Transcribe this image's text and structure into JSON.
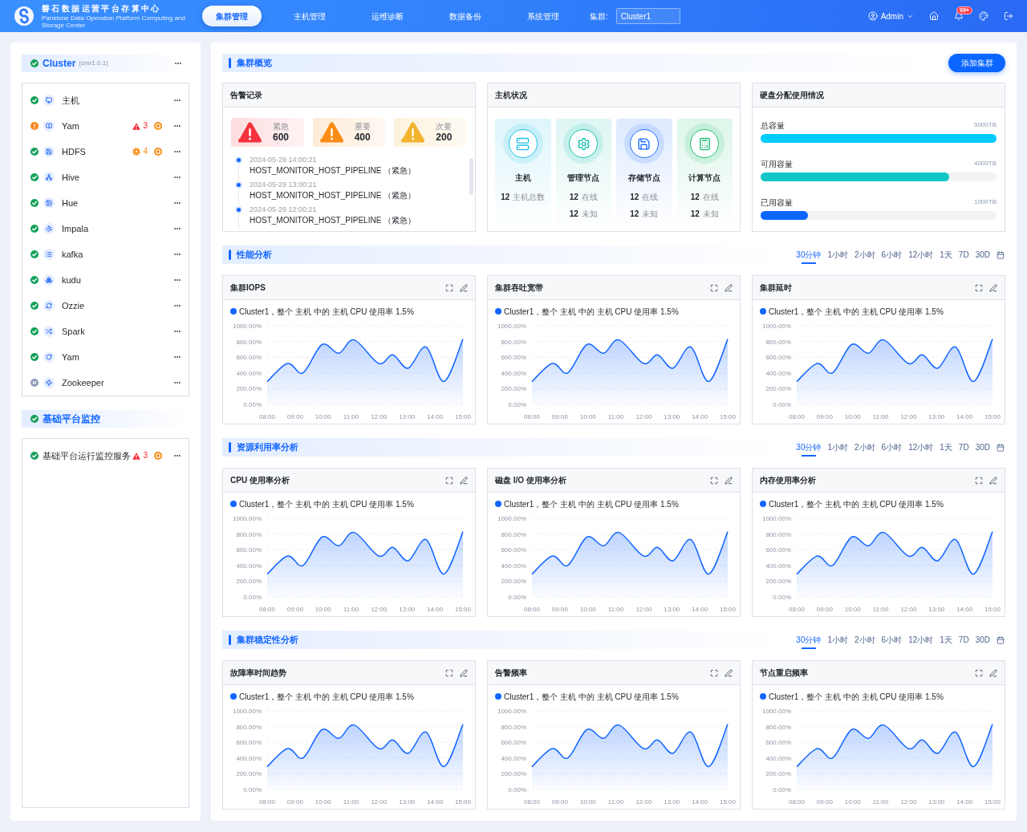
{
  "header": {
    "logo_title": "磐石数据运营平台存算中心",
    "logo_subtitle": "Panstone Data Operation Platform Computing and Storage Center",
    "nav": [
      {
        "label": "集群管理",
        "selected": true
      },
      {
        "label": "主机管理",
        "selected": false
      },
      {
        "label": "运维诊断",
        "selected": false
      },
      {
        "label": "数据备份",
        "selected": false
      },
      {
        "label": "系统管理",
        "selected": false
      }
    ],
    "cluster_label": "集群:",
    "cluster_value": "Cluster1",
    "user": "Admin",
    "notification_badge": "99+"
  },
  "sidebar": {
    "sections": [
      {
        "title": "Cluster",
        "version": "(cmr1.0.1)",
        "kind": "ok",
        "has_menu": true,
        "items": [
          {
            "name": "主机",
            "kind": "ok"
          },
          {
            "name": "Yam",
            "kind": "warning",
            "alert": {
              "kind": "critical",
              "count": "3"
            }
          },
          {
            "name": "HDFS",
            "kind": "ok",
            "alert": {
              "kind": "gear",
              "count": "4"
            }
          },
          {
            "name": "Hive",
            "kind": "ok"
          },
          {
            "name": "Hue",
            "kind": "ok"
          },
          {
            "name": "Impala",
            "kind": "ok"
          },
          {
            "name": "kafka",
            "kind": "ok"
          },
          {
            "name": "kudu",
            "kind": "ok"
          },
          {
            "name": "Ozzie",
            "kind": "ok"
          },
          {
            "name": "Spark",
            "kind": "ok"
          },
          {
            "name": "Yam",
            "kind": "ok"
          },
          {
            "name": "Zookeeper",
            "kind": "paused"
          }
        ]
      },
      {
        "title": "基础平台监控",
        "kind": "ok",
        "has_menu": false,
        "items": [
          {
            "name": "基础平台运行监控服务",
            "kind": "ok",
            "alert": {
              "kind": "critical",
              "count": "3"
            }
          }
        ]
      }
    ]
  },
  "overview": {
    "title": "集群概览",
    "add_button": "添加集群",
    "alerts_card": {
      "title": "告警记录",
      "levels": [
        {
          "label": "紧急",
          "count": "600",
          "color": "#f5333f"
        },
        {
          "label": "重要",
          "count": "400",
          "color": "#fa8c16"
        },
        {
          "label": "次要",
          "count": "200",
          "color": "#f2b32e"
        }
      ],
      "records": [
        {
          "time": "2024-05-29 14:00:21",
          "text": "HOST_MONITOR_HOST_PIPELINE （紧急）"
        },
        {
          "time": "2024-05-29 13:00:21",
          "text": "HOST_MONITOR_HOST_PIPELINE （紧急）"
        },
        {
          "time": "2024-05-29 12:00:21",
          "text": "HOST_MONITOR_HOST_PIPELINE （紧急）"
        }
      ]
    },
    "hosts_card": {
      "title": "主机状况",
      "tiles": [
        {
          "kind": "server",
          "name": "主机",
          "color": "#1fc2e6",
          "stats": [
            {
              "value": "12",
              "label": "主机总数"
            }
          ]
        },
        {
          "kind": "gear",
          "name": "管理节点",
          "color": "#17bfae",
          "stats": [
            {
              "value": "12",
              "label": "在线"
            },
            {
              "value": "12",
              "label": "未知"
            }
          ]
        },
        {
          "kind": "disk",
          "name": "存储节点",
          "color": "#1f6fff",
          "stats": [
            {
              "value": "12",
              "label": "在线"
            },
            {
              "value": "12",
              "label": "未知"
            }
          ]
        },
        {
          "kind": "calculator",
          "name": "计算节点",
          "color": "#1fbf74",
          "stats": [
            {
              "value": "12",
              "label": "在线"
            },
            {
              "value": "12",
              "label": "未知"
            }
          ]
        }
      ]
    },
    "disk_card": {
      "title": "硬盘分配使用情况",
      "rows": [
        {
          "label": "总容量",
          "value": "5000TB",
          "level": 1,
          "color": "#00cbff"
        },
        {
          "label": "可用容量",
          "value": "4000TB",
          "level": 0.8,
          "color": "#14c5c5"
        },
        {
          "label": "已用容量",
          "value": "1000TB",
          "level": 0.2,
          "color": "#0a66ff"
        }
      ]
    }
  },
  "analysis_sections": [
    {
      "title": "性能分析",
      "ranges": [
        {
          "label": "30分钟",
          "selected": true
        },
        {
          "label": "1小时",
          "selected": false
        },
        {
          "label": "2小时",
          "selected": false
        },
        {
          "label": "6小时",
          "selected": false
        },
        {
          "label": "12小时",
          "selected": false
        },
        {
          "label": "1天",
          "selected": false
        },
        {
          "label": "7D",
          "selected": false
        },
        {
          "label": "30D",
          "selected": false
        }
      ],
      "charts": [
        {
          "title": "集群IOPS",
          "chart_data": {
            "type": "area",
            "grid": true,
            "series": [
              {
                "name": "Cluster1，整个 主机 中的 主机 CPU 使用率 1.5%",
                "color": "#1366ff",
                "values": [
                  290,
                  520,
                  400,
                  760,
                  650,
                  820,
                  520,
                  630,
                  460,
                  730,
                  290,
                  830
                ]
              }
            ],
            "x": [
              8,
              8.73,
              9.28,
              9.96,
              10.56,
              11.11,
              11.99,
              12.49,
              13.04,
              13.68,
              14.32,
              15
            ],
            "xlim": [
              8,
              15
            ],
            "ylim": [
              0,
              1000
            ],
            "xticks": [
              {
                "value": 8,
                "label": "08:00"
              },
              {
                "value": 9,
                "label": "09:00"
              },
              {
                "value": 10,
                "label": "10:00"
              },
              {
                "value": 11,
                "label": "11:00"
              },
              {
                "value": 12,
                "label": "12:00"
              },
              {
                "value": 13,
                "label": "13:00"
              },
              {
                "value": 14,
                "label": "14:00"
              },
              {
                "value": 15,
                "label": "15:00"
              }
            ],
            "yticks": [
              {
                "value": 0,
                "label": "0.00%"
              },
              {
                "value": 200,
                "label": "200.00%"
              },
              {
                "value": 400,
                "label": "400.00%"
              },
              {
                "value": 600,
                "label": "600.00%"
              },
              {
                "value": 800,
                "label": "800.00%"
              },
              {
                "value": 1000,
                "label": "1000.00%"
              }
            ]
          }
        },
        {
          "title": "集群吞吐宽带",
          "chart_data": {
            "type": "area",
            "grid": true,
            "series": [
              {
                "name": "Cluster1，整个 主机 中的 主机 CPU 使用率 1.5%",
                "color": "#1366ff",
                "values": [
                  290,
                  520,
                  400,
                  760,
                  650,
                  820,
                  520,
                  630,
                  460,
                  730,
                  290,
                  830
                ]
              }
            ],
            "x": [
              8,
              8.73,
              9.28,
              9.96,
              10.56,
              11.11,
              11.99,
              12.49,
              13.04,
              13.68,
              14.32,
              15
            ],
            "xlim": [
              8,
              15
            ],
            "ylim": [
              0,
              1000
            ],
            "xticks": [
              {
                "value": 8,
                "label": "08:00"
              },
              {
                "value": 9,
                "label": "09:00"
              },
              {
                "value": 10,
                "label": "10:00"
              },
              {
                "value": 11,
                "label": "11:00"
              },
              {
                "value": 12,
                "label": "12:00"
              },
              {
                "value": 13,
                "label": "13:00"
              },
              {
                "value": 14,
                "label": "14:00"
              },
              {
                "value": 15,
                "label": "15:00"
              }
            ],
            "yticks": [
              {
                "value": 0,
                "label": "0.00%"
              },
              {
                "value": 200,
                "label": "200.00%"
              },
              {
                "value": 400,
                "label": "400.00%"
              },
              {
                "value": 600,
                "label": "600.00%"
              },
              {
                "value": 800,
                "label": "800.00%"
              },
              {
                "value": 1000,
                "label": "1000.00%"
              }
            ]
          }
        },
        {
          "title": "集群延时",
          "chart_data": {
            "type": "area",
            "grid": true,
            "series": [
              {
                "name": "Cluster1，整个 主机 中的 主机 CPU 使用率 1.5%",
                "color": "#1366ff",
                "values": [
                  290,
                  520,
                  400,
                  760,
                  650,
                  820,
                  520,
                  630,
                  460,
                  730,
                  290,
                  830
                ]
              }
            ],
            "x": [
              8,
              8.73,
              9.28,
              9.96,
              10.56,
              11.11,
              11.99,
              12.49,
              13.04,
              13.68,
              14.32,
              15
            ],
            "xlim": [
              8,
              15
            ],
            "ylim": [
              0,
              1000
            ],
            "xticks": [
              {
                "value": 8,
                "label": "08:00"
              },
              {
                "value": 9,
                "label": "09:00"
              },
              {
                "value": 10,
                "label": "10:00"
              },
              {
                "value": 11,
                "label": "11:00"
              },
              {
                "value": 12,
                "label": "12:00"
              },
              {
                "value": 13,
                "label": "13:00"
              },
              {
                "value": 14,
                "label": "14:00"
              },
              {
                "value": 15,
                "label": "15:00"
              }
            ],
            "yticks": [
              {
                "value": 0,
                "label": "0.00%"
              },
              {
                "value": 200,
                "label": "200.00%"
              },
              {
                "value": 400,
                "label": "400.00%"
              },
              {
                "value": 600,
                "label": "600.00%"
              },
              {
                "value": 800,
                "label": "800.00%"
              },
              {
                "value": 1000,
                "label": "1000.00%"
              }
            ]
          }
        }
      ]
    },
    {
      "title": "资源利用率分析",
      "ranges": [
        {
          "label": "30分钟",
          "selected": true
        },
        {
          "label": "1小时",
          "selected": false
        },
        {
          "label": "2小时",
          "selected": false
        },
        {
          "label": "6小时",
          "selected": false
        },
        {
          "label": "12小时",
          "selected": false
        },
        {
          "label": "1天",
          "selected": false
        },
        {
          "label": "7D",
          "selected": false
        },
        {
          "label": "30D",
          "selected": false
        }
      ],
      "charts": [
        {
          "title": "CPU 使用率分析",
          "chart_data": {
            "type": "area",
            "grid": true,
            "series": [
              {
                "name": "Cluster1，整个 主机 中的 主机 CPU 使用率 1.5%",
                "color": "#1366ff",
                "values": [
                  290,
                  520,
                  400,
                  760,
                  650,
                  820,
                  520,
                  630,
                  460,
                  730,
                  290,
                  830
                ]
              }
            ],
            "x": [
              8,
              8.73,
              9.28,
              9.96,
              10.56,
              11.11,
              11.99,
              12.49,
              13.04,
              13.68,
              14.32,
              15
            ],
            "xlim": [
              8,
              15
            ],
            "ylim": [
              0,
              1000
            ],
            "xticks": [
              {
                "value": 8,
                "label": "08:00"
              },
              {
                "value": 9,
                "label": "09:00"
              },
              {
                "value": 10,
                "label": "10:00"
              },
              {
                "value": 11,
                "label": "11:00"
              },
              {
                "value": 12,
                "label": "12:00"
              },
              {
                "value": 13,
                "label": "13:00"
              },
              {
                "value": 14,
                "label": "14:00"
              },
              {
                "value": 15,
                "label": "15:00"
              }
            ],
            "yticks": [
              {
                "value": 0,
                "label": "0.00%"
              },
              {
                "value": 200,
                "label": "200.00%"
              },
              {
                "value": 400,
                "label": "400.00%"
              },
              {
                "value": 600,
                "label": "600.00%"
              },
              {
                "value": 800,
                "label": "800.00%"
              },
              {
                "value": 1000,
                "label": "1000.00%"
              }
            ]
          }
        },
        {
          "title": "磁盘 I/O 使用率分析",
          "chart_data": {
            "type": "area",
            "grid": true,
            "series": [
              {
                "name": "Cluster1，整个 主机 中的 主机 CPU 使用率 1.5%",
                "color": "#1366ff",
                "values": [
                  290,
                  520,
                  400,
                  760,
                  650,
                  820,
                  520,
                  630,
                  460,
                  730,
                  290,
                  830
                ]
              }
            ],
            "x": [
              8,
              8.73,
              9.28,
              9.96,
              10.56,
              11.11,
              11.99,
              12.49,
              13.04,
              13.68,
              14.32,
              15
            ],
            "xlim": [
              8,
              15
            ],
            "ylim": [
              0,
              1000
            ],
            "xticks": [
              {
                "value": 8,
                "label": "08:00"
              },
              {
                "value": 9,
                "label": "09:00"
              },
              {
                "value": 10,
                "label": "10:00"
              },
              {
                "value": 11,
                "label": "11:00"
              },
              {
                "value": 12,
                "label": "12:00"
              },
              {
                "value": 13,
                "label": "13:00"
              },
              {
                "value": 14,
                "label": "14:00"
              },
              {
                "value": 15,
                "label": "15:00"
              }
            ],
            "yticks": [
              {
                "value": 0,
                "label": "0.00%"
              },
              {
                "value": 200,
                "label": "200.00%"
              },
              {
                "value": 400,
                "label": "400.00%"
              },
              {
                "value": 600,
                "label": "600.00%"
              },
              {
                "value": 800,
                "label": "800.00%"
              },
              {
                "value": 1000,
                "label": "1000.00%"
              }
            ]
          }
        },
        {
          "title": "内存使用率分析",
          "chart_data": {
            "type": "area",
            "grid": true,
            "series": [
              {
                "name": "Cluster1，整个 主机 中的 主机 CPU 使用率 1.5%",
                "color": "#1366ff",
                "values": [
                  290,
                  520,
                  400,
                  760,
                  650,
                  820,
                  520,
                  630,
                  460,
                  730,
                  290,
                  830
                ]
              }
            ],
            "x": [
              8,
              8.73,
              9.28,
              9.96,
              10.56,
              11.11,
              11.99,
              12.49,
              13.04,
              13.68,
              14.32,
              15
            ],
            "xlim": [
              8,
              15
            ],
            "ylim": [
              0,
              1000
            ],
            "xticks": [
              {
                "value": 8,
                "label": "08:00"
              },
              {
                "value": 9,
                "label": "09:00"
              },
              {
                "value": 10,
                "label": "10:00"
              },
              {
                "value": 11,
                "label": "11:00"
              },
              {
                "value": 12,
                "label": "12:00"
              },
              {
                "value": 13,
                "label": "13:00"
              },
              {
                "value": 14,
                "label": "14:00"
              },
              {
                "value": 15,
                "label": "15:00"
              }
            ],
            "yticks": [
              {
                "value": 0,
                "label": "0.00%"
              },
              {
                "value": 200,
                "label": "200.00%"
              },
              {
                "value": 400,
                "label": "400.00%"
              },
              {
                "value": 600,
                "label": "600.00%"
              },
              {
                "value": 800,
                "label": "800.00%"
              },
              {
                "value": 1000,
                "label": "1000.00%"
              }
            ]
          }
        }
      ]
    },
    {
      "title": "集群稳定性分析",
      "ranges": [
        {
          "label": "30分钟",
          "selected": true
        },
        {
          "label": "1小时",
          "selected": false
        },
        {
          "label": "2小时",
          "selected": false
        },
        {
          "label": "6小时",
          "selected": false
        },
        {
          "label": "12小时",
          "selected": false
        },
        {
          "label": "1天",
          "selected": false
        },
        {
          "label": "7D",
          "selected": false
        },
        {
          "label": "30D",
          "selected": false
        }
      ],
      "charts": [
        {
          "title": "故障率时间趋势",
          "chart_data": {
            "type": "area",
            "grid": true,
            "series": [
              {
                "name": "Cluster1，整个 主机 中的 主机 CPU 使用率 1.5%",
                "color": "#1366ff",
                "values": [
                  290,
                  520,
                  400,
                  760,
                  650,
                  820,
                  520,
                  630,
                  460,
                  730,
                  290,
                  830
                ]
              }
            ],
            "x": [
              8,
              8.73,
              9.28,
              9.96,
              10.56,
              11.11,
              11.99,
              12.49,
              13.04,
              13.68,
              14.32,
              15
            ],
            "xlim": [
              8,
              15
            ],
            "ylim": [
              0,
              1000
            ],
            "xticks": [
              {
                "value": 8,
                "label": "08:00"
              },
              {
                "value": 9,
                "label": "09:00"
              },
              {
                "value": 10,
                "label": "10:00"
              },
              {
                "value": 11,
                "label": "11:00"
              },
              {
                "value": 12,
                "label": "12:00"
              },
              {
                "value": 13,
                "label": "13:00"
              },
              {
                "value": 14,
                "label": "14:00"
              },
              {
                "value": 15,
                "label": "15:00"
              }
            ],
            "yticks": [
              {
                "value": 0,
                "label": "0.00%"
              },
              {
                "value": 200,
                "label": "200.00%"
              },
              {
                "value": 400,
                "label": "400.00%"
              },
              {
                "value": 600,
                "label": "600.00%"
              },
              {
                "value": 800,
                "label": "800.00%"
              },
              {
                "value": 1000,
                "label": "1000.00%"
              }
            ]
          }
        },
        {
          "title": "告警频率",
          "chart_data": {
            "type": "area",
            "grid": true,
            "series": [
              {
                "name": "Cluster1，整个 主机 中的 主机 CPU 使用率 1.5%",
                "color": "#1366ff",
                "values": [
                  290,
                  520,
                  400,
                  760,
                  650,
                  820,
                  520,
                  630,
                  460,
                  730,
                  290,
                  830
                ]
              }
            ],
            "x": [
              8,
              8.73,
              9.28,
              9.96,
              10.56,
              11.11,
              11.99,
              12.49,
              13.04,
              13.68,
              14.32,
              15
            ],
            "xlim": [
              8,
              15
            ],
            "ylim": [
              0,
              1000
            ],
            "xticks": [
              {
                "value": 8,
                "label": "08:00"
              },
              {
                "value": 9,
                "label": "09:00"
              },
              {
                "value": 10,
                "label": "10:00"
              },
              {
                "value": 11,
                "label": "11:00"
              },
              {
                "value": 12,
                "label": "12:00"
              },
              {
                "value": 13,
                "label": "13:00"
              },
              {
                "value": 14,
                "label": "14:00"
              },
              {
                "value": 15,
                "label": "15:00"
              }
            ],
            "yticks": [
              {
                "value": 0,
                "label": "0.00%"
              },
              {
                "value": 200,
                "label": "200.00%"
              },
              {
                "value": 400,
                "label": "400.00%"
              },
              {
                "value": 600,
                "label": "600.00%"
              },
              {
                "value": 800,
                "label": "800.00%"
              },
              {
                "value": 1000,
                "label": "1000.00%"
              }
            ]
          }
        },
        {
          "title": "节点重启频率",
          "chart_data": {
            "type": "area",
            "grid": true,
            "series": [
              {
                "name": "Cluster1，整个 主机 中的 主机 CPU 使用率 1.5%",
                "color": "#1366ff",
                "values": [
                  290,
                  520,
                  400,
                  760,
                  650,
                  820,
                  520,
                  630,
                  460,
                  730,
                  290,
                  830
                ]
              }
            ],
            "x": [
              8,
              8.73,
              9.28,
              9.96,
              10.56,
              11.11,
              11.99,
              12.49,
              13.04,
              13.68,
              14.32,
              15
            ],
            "xlim": [
              8,
              15
            ],
            "ylim": [
              0,
              1000
            ],
            "xticks": [
              {
                "value": 8,
                "label": "08:00"
              },
              {
                "value": 9,
                "label": "09:00"
              },
              {
                "value": 10,
                "label": "10:00"
              },
              {
                "value": 11,
                "label": "11:00"
              },
              {
                "value": 12,
                "label": "12:00"
              },
              {
                "value": 13,
                "label": "13:00"
              },
              {
                "value": 14,
                "label": "14:00"
              },
              {
                "value": 15,
                "label": "15:00"
              }
            ],
            "yticks": [
              {
                "value": 0,
                "label": "0.00%"
              },
              {
                "value": 200,
                "label": "200.00%"
              },
              {
                "value": 400,
                "label": "400.00%"
              },
              {
                "value": 600,
                "label": "600.00%"
              },
              {
                "value": 800,
                "label": "800.00%"
              },
              {
                "value": 1000,
                "label": "1000.00%"
              }
            ]
          }
        }
      ]
    }
  ]
}
